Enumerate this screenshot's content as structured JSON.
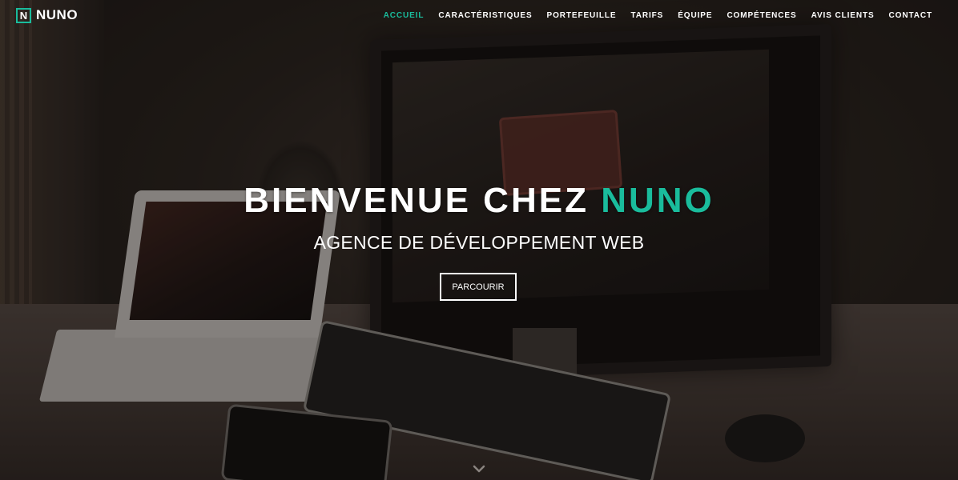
{
  "brand": {
    "icon_letter": "N",
    "name": "NUNO"
  },
  "nav": {
    "items": [
      {
        "label": "ACCUEIL",
        "active": true
      },
      {
        "label": "CARACTÉRISTIQUES",
        "active": false
      },
      {
        "label": "PORTEFEUILLE",
        "active": false
      },
      {
        "label": "TARIFS",
        "active": false
      },
      {
        "label": "ÉQUIPE",
        "active": false
      },
      {
        "label": "COMPÉTENCES",
        "active": false
      },
      {
        "label": "AVIS CLIENTS",
        "active": false
      },
      {
        "label": "CONTACT",
        "active": false
      }
    ]
  },
  "hero": {
    "title_main": "BIENVENUE CHEZ ",
    "title_accent": "NUNO",
    "subtitle": "AGENCE DE DÉVELOPPEMENT WEB",
    "button_label": "PARCOURIR",
    "scroll_icon": "chevron-down-icon"
  },
  "colors": {
    "accent": "#1abc9c",
    "text": "#ffffff"
  }
}
